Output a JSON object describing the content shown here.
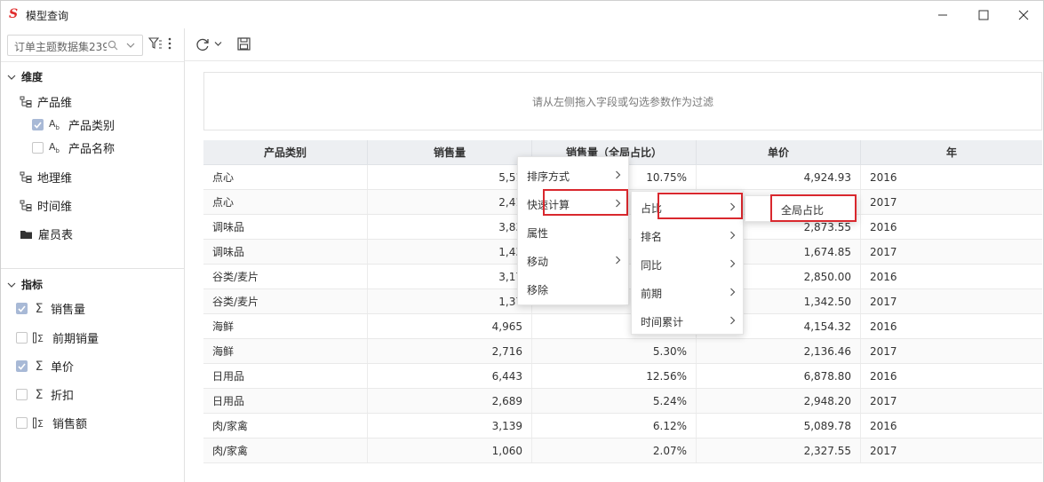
{
  "window": {
    "title": "模型查询"
  },
  "left": {
    "search_value": "订单主题数据集239",
    "dimensions_title": "维度",
    "dimension_groups": [
      {
        "label": "产品维",
        "fields": [
          {
            "label": "产品类别",
            "checked": true
          },
          {
            "label": "产品名称",
            "checked": false
          }
        ]
      },
      {
        "label": "地理维"
      },
      {
        "label": "时间维"
      },
      {
        "label": "雇员表"
      }
    ],
    "measures_title": "指标",
    "measures": [
      {
        "label": "销售量",
        "checked": true,
        "icon": "sigma-icon"
      },
      {
        "label": "前期销量",
        "checked": false,
        "icon": "calc-field-icon"
      },
      {
        "label": "单价",
        "checked": true,
        "icon": "sigma-icon"
      },
      {
        "label": "折扣",
        "checked": false,
        "icon": "sigma-icon"
      },
      {
        "label": "销售额",
        "checked": false,
        "icon": "calc-field-icon"
      }
    ]
  },
  "main": {
    "filter_hint": "请从左侧拖入字段或勾选参数作为过滤",
    "columns": [
      "产品类别",
      "销售量",
      "销售量（全局占比）",
      "单价",
      "年"
    ],
    "rows": [
      [
        "点心",
        "5,51",
        "10.75%",
        "4,924.93",
        "2016"
      ],
      [
        "点心",
        "2,41",
        "",
        "",
        "2017"
      ],
      [
        "调味品",
        "3,83",
        "",
        "2,873.55",
        "2016"
      ],
      [
        "调味品",
        "1,43",
        "",
        "1,674.85",
        "2017"
      ],
      [
        "谷类/麦片",
        "3,17",
        "",
        "2,850.00",
        "2016"
      ],
      [
        "谷类/麦片",
        "1,37",
        "",
        "1,342.50",
        "2017"
      ],
      [
        "海鲜",
        "4,965",
        "",
        "4,154.32",
        "2016"
      ],
      [
        "海鲜",
        "2,716",
        "5.30%",
        "2,136.46",
        "2017"
      ],
      [
        "日用品",
        "6,443",
        "12.56%",
        "6,878.80",
        "2016"
      ],
      [
        "日用品",
        "2,689",
        "5.24%",
        "2,948.20",
        "2017"
      ],
      [
        "肉/家禽",
        "3,139",
        "6.12%",
        "5,089.78",
        "2016"
      ],
      [
        "肉/家禽",
        "1,060",
        "2.07%",
        "2,327.55",
        "2017"
      ]
    ]
  },
  "menus": {
    "level1": [
      "排序方式",
      "快速计算",
      "属性",
      "移动",
      "移除"
    ],
    "level2": [
      "占比",
      "排名",
      "同比",
      "前期",
      "时间累计"
    ],
    "level3": [
      "全局占比"
    ]
  },
  "colors": {
    "accent": "#d9282e",
    "checked": "#a8b9d6",
    "header_bg": "#edeff2"
  }
}
